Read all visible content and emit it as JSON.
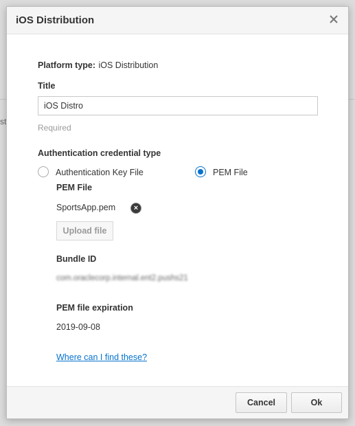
{
  "background": {
    "fragment_text": "str"
  },
  "dialog": {
    "title": "iOS Distribution",
    "close_icon": "close-icon"
  },
  "form": {
    "platform_type_label": "Platform type:",
    "platform_type_value": "iOS Distribution",
    "title_label": "Title",
    "title_value": "iOS Distro",
    "title_required_hint": "Required",
    "auth_type_label": "Authentication credential type",
    "auth_options": [
      {
        "label": "Authentication Key File",
        "selected": false
      },
      {
        "label": "PEM File",
        "selected": true
      }
    ],
    "pem_file_label": "PEM File",
    "pem_file_name": "SportsApp.pem",
    "upload_button_label": "Upload file",
    "bundle_id_label": "Bundle ID",
    "bundle_id_value": "com.oraclecorp.internal.ent2.pushs21",
    "expiration_label": "PEM file expiration",
    "expiration_value": "2019-09-08",
    "help_link": "Where can I find these?"
  },
  "footer": {
    "cancel_label": "Cancel",
    "ok_label": "Ok"
  },
  "colors": {
    "accent": "#0572ce",
    "hint": "#9a9a9a",
    "text": "#333333"
  }
}
